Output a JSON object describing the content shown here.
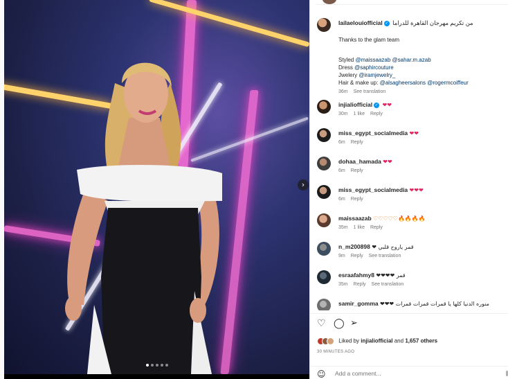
{
  "post": {
    "top_username": "lailaelouiofficial",
    "next_arrow": "›",
    "dots_count": 5,
    "active_dot": 0
  },
  "caption": {
    "username": "lailaelouiofficial",
    "arabic_line": "من تكريم مهرجان القاهرة للدراما",
    "thanks": "Thanks to the glam team",
    "styled_prefix": "Styled",
    "styled_mentions": "@maissaazab @sahar.m.azab",
    "dress_prefix": "Dress",
    "dress_mention": "@saphircouture",
    "jewelry_prefix": "Jwelery",
    "jewelry_mention": "@iramjewelry_",
    "hair_prefix": "Hair & make up:",
    "hair_mentions": "@alsagheersalons @rogermcoiffeur",
    "time": "36m",
    "see_translation": "See translation"
  },
  "comments": [
    {
      "username": "injialiofficial",
      "verified": true,
      "text": "❤❤",
      "time": "30m",
      "likes": "1 like",
      "reply": "Reply",
      "see_translation": ""
    },
    {
      "username": "miss_egypt_socialmedia",
      "verified": false,
      "text": "❤❤",
      "time": "6m",
      "likes": "",
      "reply": "Reply",
      "see_translation": ""
    },
    {
      "username": "dohaa_hamada",
      "verified": false,
      "text": "❤❤",
      "time": "6m",
      "likes": "",
      "reply": "Reply",
      "see_translation": ""
    },
    {
      "username": "miss_egypt_socialmedia",
      "verified": false,
      "text": "❤❤❤",
      "time": "6m",
      "likes": "",
      "reply": "Reply",
      "see_translation": ""
    },
    {
      "username": "maissaazab",
      "verified": false,
      "text": "♡♡♡♡♡🔥🔥🔥🔥",
      "time": "35m",
      "likes": "1 like",
      "reply": "Reply",
      "see_translation": ""
    },
    {
      "username": "n_m200898",
      "verified": false,
      "text": "قمر ياروح قلبي ❤",
      "time": "9m",
      "likes": "",
      "reply": "Reply",
      "see_translation": "See translation"
    },
    {
      "username": "esraafahmy8",
      "verified": false,
      "text": "❤❤❤❤ قمر",
      "time": "35m",
      "likes": "",
      "reply": "Reply",
      "see_translation": "See translation"
    },
    {
      "username": "samir_gomma",
      "verified": false,
      "text": "❤❤❤ منوره الدنيا كلها يا قمرات قمرات قمرات",
      "time": "",
      "likes": "",
      "reply": "",
      "see_translation": ""
    }
  ],
  "actions": {
    "like_icon": "heart-icon",
    "comment_icon": "comment-icon",
    "share_icon": "share-icon",
    "liked_prefix": "Liked by",
    "liked_user": "injialiofficial",
    "liked_and": "and",
    "liked_others": "1,657 others",
    "time_ago": "30 MINUTES AGO"
  },
  "add_comment": {
    "placeholder": "Add a comment..."
  },
  "colors": {
    "verified": "#0095f6",
    "heart": "#e0245e",
    "mention": "#00376b",
    "meta": "#737373"
  }
}
